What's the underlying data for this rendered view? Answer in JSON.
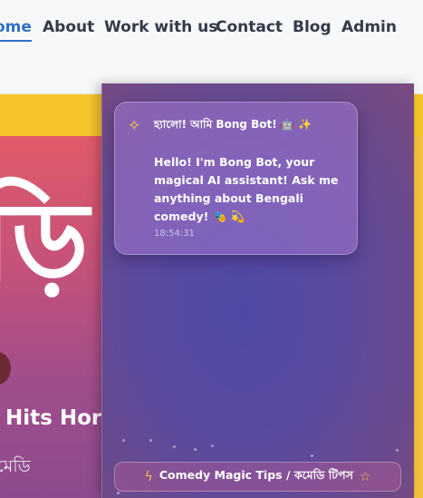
{
  "nav": {
    "items": [
      {
        "label": "ome",
        "active": true
      },
      {
        "label": "About"
      },
      {
        "label": "Work with us"
      },
      {
        "label": "Contact"
      },
      {
        "label": "Blog"
      },
      {
        "label": "Admin"
      }
    ]
  },
  "hero": {
    "big_text": "ড়ি",
    "subtitle": "Hits Hor",
    "small_text": "মেডি"
  },
  "chat": {
    "message": {
      "icon": "sparkles-icon",
      "header": "হ্যালো! আমি Bong Bot! 🤖 ✨",
      "body": "Hello! I'm Bong Bot, your magical AI assistant! Ask me anything about Bengali comedy! 🎭 💫",
      "time": "18:54:31"
    },
    "tips": {
      "icon": "lightning-icon",
      "label": "Comedy Magic Tips / কমেডি টিপস",
      "trailing_icon": "star-icon"
    }
  },
  "colors": {
    "nav_text": "#343a48",
    "nav_active": "#2f6fc9",
    "yellow": "#f7c52b",
    "panel": "#5a4aa0"
  }
}
